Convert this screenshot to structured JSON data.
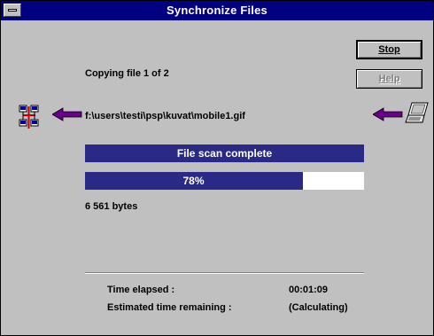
{
  "window": {
    "title": "Synchronize Files"
  },
  "buttons": {
    "stop_label": "Stop",
    "help_label": "Help"
  },
  "copy": {
    "status_line": "Copying file 1 of 2",
    "file_path": "f:\\users\\testi\\psp\\kuvat\\mobile1.gif",
    "scan_status": "File scan complete",
    "progress_text": "78%",
    "progress": 0.78,
    "bytes": "6 561 bytes"
  },
  "timing": {
    "elapsed_label": "Time elapsed :",
    "elapsed_value": "00:01:09",
    "remaining_label": "Estimated time remaining :",
    "remaining_value": "(Calculating)"
  },
  "icons": {
    "source": "network-connection-icon",
    "arrow_left": "arrow-left-icon",
    "arrow_right": "arrow-left-icon",
    "target": "laptop-icon"
  },
  "colors": {
    "title_bar": "#000080",
    "progress_fill": "#2a2a86",
    "background": "#c0c0c0"
  }
}
